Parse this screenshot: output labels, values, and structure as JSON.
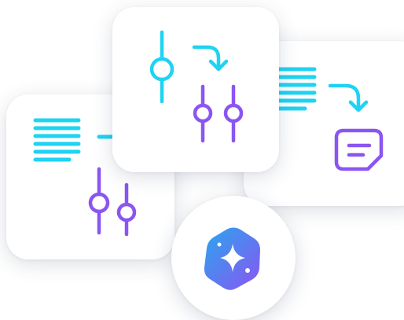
{
  "colors": {
    "cyan": "#1fd3f2",
    "purple": "#8a55f2",
    "blue": "#2aa6ee",
    "badge_gradient_start": "#2aa6ee",
    "badge_gradient_end": "#8a55f2",
    "card_background": "#ffffff"
  },
  "cards": {
    "left": {
      "icons": [
        "text-lines-icon",
        "arrow-right-icon",
        "sliders-icon"
      ]
    },
    "top": {
      "icons": [
        "slider-icon",
        "curved-arrow-icon",
        "sliders-icon"
      ]
    },
    "right": {
      "icons": [
        "text-lines-icon",
        "curved-arrow-icon",
        "note-icon"
      ]
    }
  },
  "badge": {
    "icon": "sparkle-logo-icon"
  }
}
